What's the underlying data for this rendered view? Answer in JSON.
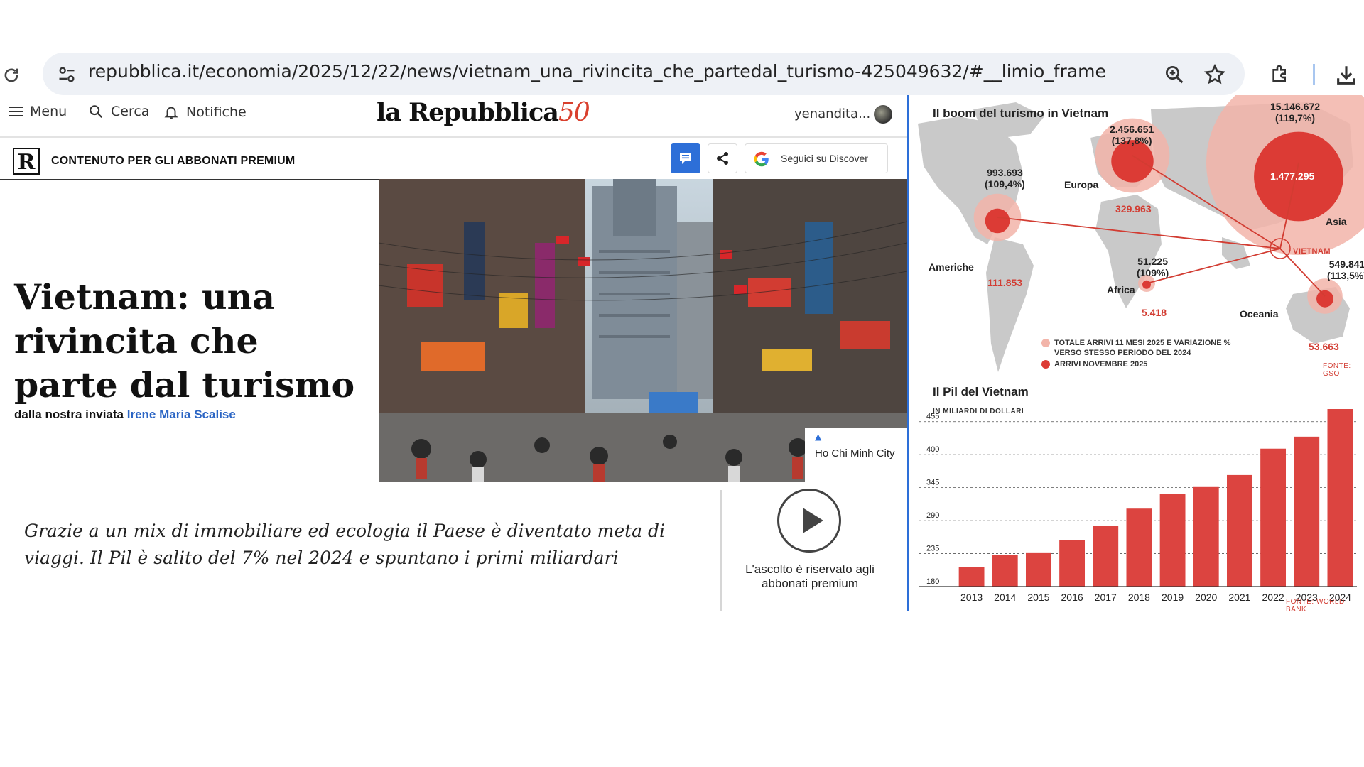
{
  "browser": {
    "url": "repubblica.it/economia/2025/12/22/news/vietnam_una_rivincita_che_partedal_turismo-425049632/#__limio_frame"
  },
  "nav": {
    "menu": "Menu",
    "search": "Cerca",
    "notifications": "Notifiche",
    "logo_text": "la Repubblica",
    "logo_50": "50",
    "user": "yenandita..."
  },
  "premium": {
    "logo": "R",
    "label": "CONTENUTO PER GLI ABBONATI PREMIUM",
    "discover": "Seguici su Discover"
  },
  "article": {
    "headline": "Vietnam: una rivincita che parte dal turismo",
    "byline_prefix": "dalla nostra inviata ",
    "author": "Irene Maria Scalise",
    "photo_caption": "Ho Chi Minh City",
    "summary": "Grazie a un mix di immobiliare ed ecologia il Paese è diventato meta di viaggi. Il Pil è salito del 7% nel 2024 e spuntano i primi miliardari",
    "audio_note": "L'ascolto è riservato agli abbonati premium"
  },
  "tourism_map": {
    "title": "Il boom del turismo in Vietnam",
    "regions": [
      {
        "name": "Americhe",
        "total": "993.693",
        "change": "(109,4%)",
        "november": "111.853"
      },
      {
        "name": "Europa",
        "total": "2.456.651",
        "change": "(137,8%)",
        "november": "329.963"
      },
      {
        "name": "Asia",
        "total": "15.146.672",
        "change": "(119,7%)",
        "november": "1.477.295"
      },
      {
        "name": "Africa",
        "total": "51.225",
        "change": "(109%)",
        "november": "5.418"
      },
      {
        "name": "Oceania",
        "total": "549.841",
        "change": "(113,5%)",
        "november": "53.663"
      }
    ],
    "destination": "VIETNAM",
    "legend_total_line1": "TOTALE ARRIVI 11 MESI 2025 E VARIAZIONE %",
    "legend_total_line2": "VERSO STESSO PERIODO DEL 2024",
    "legend_november": "ARRIVI NOVEMBRE 2025",
    "source": "FONTE: GSO",
    "colors": {
      "total": "#f2b4a9",
      "november": "#dc3b35"
    }
  },
  "chart_data": {
    "type": "bar",
    "title": "Il Pil del Vietnam",
    "subtitle": "IN MILIARDI DI DOLLARI",
    "categories": [
      "2013",
      "2014",
      "2015",
      "2016",
      "2017",
      "2018",
      "2019",
      "2020",
      "2021",
      "2022",
      "2023",
      "2024"
    ],
    "values": [
      213,
      233,
      237,
      257,
      281,
      310,
      334,
      346,
      366,
      410,
      430,
      476
    ],
    "yticks": [
      180,
      235,
      290,
      345,
      400,
      455
    ],
    "ylim": [
      180,
      476
    ],
    "grid": true,
    "bar_color": "#dc4440",
    "source": "FONTE: WORLD BANK"
  }
}
